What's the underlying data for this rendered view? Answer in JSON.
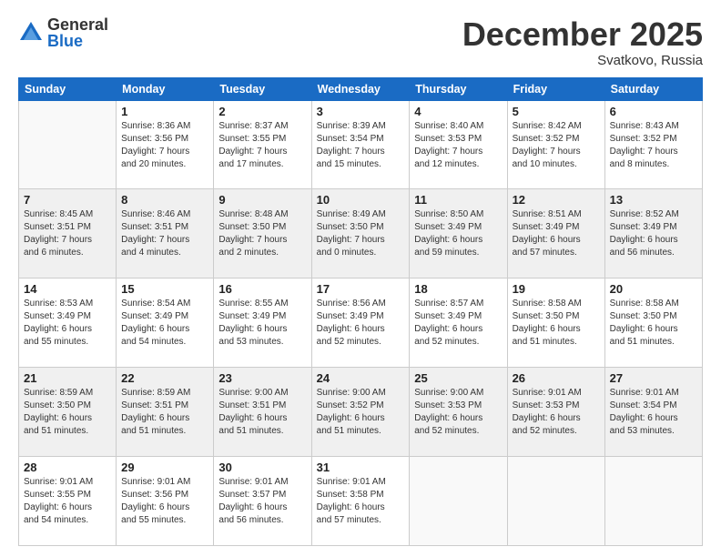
{
  "header": {
    "logo": {
      "general": "General",
      "blue": "Blue"
    },
    "title": "December 2025",
    "location": "Svatkovo, Russia"
  },
  "weekdays": [
    "Sunday",
    "Monday",
    "Tuesday",
    "Wednesday",
    "Thursday",
    "Friday",
    "Saturday"
  ],
  "weeks": [
    [
      {
        "day": "",
        "info": ""
      },
      {
        "day": "1",
        "info": "Sunrise: 8:36 AM\nSunset: 3:56 PM\nDaylight: 7 hours\nand 20 minutes."
      },
      {
        "day": "2",
        "info": "Sunrise: 8:37 AM\nSunset: 3:55 PM\nDaylight: 7 hours\nand 17 minutes."
      },
      {
        "day": "3",
        "info": "Sunrise: 8:39 AM\nSunset: 3:54 PM\nDaylight: 7 hours\nand 15 minutes."
      },
      {
        "day": "4",
        "info": "Sunrise: 8:40 AM\nSunset: 3:53 PM\nDaylight: 7 hours\nand 12 minutes."
      },
      {
        "day": "5",
        "info": "Sunrise: 8:42 AM\nSunset: 3:52 PM\nDaylight: 7 hours\nand 10 minutes."
      },
      {
        "day": "6",
        "info": "Sunrise: 8:43 AM\nSunset: 3:52 PM\nDaylight: 7 hours\nand 8 minutes."
      }
    ],
    [
      {
        "day": "7",
        "info": "Sunrise: 8:45 AM\nSunset: 3:51 PM\nDaylight: 7 hours\nand 6 minutes."
      },
      {
        "day": "8",
        "info": "Sunrise: 8:46 AM\nSunset: 3:51 PM\nDaylight: 7 hours\nand 4 minutes."
      },
      {
        "day": "9",
        "info": "Sunrise: 8:48 AM\nSunset: 3:50 PM\nDaylight: 7 hours\nand 2 minutes."
      },
      {
        "day": "10",
        "info": "Sunrise: 8:49 AM\nSunset: 3:50 PM\nDaylight: 7 hours\nand 0 minutes."
      },
      {
        "day": "11",
        "info": "Sunrise: 8:50 AM\nSunset: 3:49 PM\nDaylight: 6 hours\nand 59 minutes."
      },
      {
        "day": "12",
        "info": "Sunrise: 8:51 AM\nSunset: 3:49 PM\nDaylight: 6 hours\nand 57 minutes."
      },
      {
        "day": "13",
        "info": "Sunrise: 8:52 AM\nSunset: 3:49 PM\nDaylight: 6 hours\nand 56 minutes."
      }
    ],
    [
      {
        "day": "14",
        "info": "Sunrise: 8:53 AM\nSunset: 3:49 PM\nDaylight: 6 hours\nand 55 minutes."
      },
      {
        "day": "15",
        "info": "Sunrise: 8:54 AM\nSunset: 3:49 PM\nDaylight: 6 hours\nand 54 minutes."
      },
      {
        "day": "16",
        "info": "Sunrise: 8:55 AM\nSunset: 3:49 PM\nDaylight: 6 hours\nand 53 minutes."
      },
      {
        "day": "17",
        "info": "Sunrise: 8:56 AM\nSunset: 3:49 PM\nDaylight: 6 hours\nand 52 minutes."
      },
      {
        "day": "18",
        "info": "Sunrise: 8:57 AM\nSunset: 3:49 PM\nDaylight: 6 hours\nand 52 minutes."
      },
      {
        "day": "19",
        "info": "Sunrise: 8:58 AM\nSunset: 3:50 PM\nDaylight: 6 hours\nand 51 minutes."
      },
      {
        "day": "20",
        "info": "Sunrise: 8:58 AM\nSunset: 3:50 PM\nDaylight: 6 hours\nand 51 minutes."
      }
    ],
    [
      {
        "day": "21",
        "info": "Sunrise: 8:59 AM\nSunset: 3:50 PM\nDaylight: 6 hours\nand 51 minutes."
      },
      {
        "day": "22",
        "info": "Sunrise: 8:59 AM\nSunset: 3:51 PM\nDaylight: 6 hours\nand 51 minutes."
      },
      {
        "day": "23",
        "info": "Sunrise: 9:00 AM\nSunset: 3:51 PM\nDaylight: 6 hours\nand 51 minutes."
      },
      {
        "day": "24",
        "info": "Sunrise: 9:00 AM\nSunset: 3:52 PM\nDaylight: 6 hours\nand 51 minutes."
      },
      {
        "day": "25",
        "info": "Sunrise: 9:00 AM\nSunset: 3:53 PM\nDaylight: 6 hours\nand 52 minutes."
      },
      {
        "day": "26",
        "info": "Sunrise: 9:01 AM\nSunset: 3:53 PM\nDaylight: 6 hours\nand 52 minutes."
      },
      {
        "day": "27",
        "info": "Sunrise: 9:01 AM\nSunset: 3:54 PM\nDaylight: 6 hours\nand 53 minutes."
      }
    ],
    [
      {
        "day": "28",
        "info": "Sunrise: 9:01 AM\nSunset: 3:55 PM\nDaylight: 6 hours\nand 54 minutes."
      },
      {
        "day": "29",
        "info": "Sunrise: 9:01 AM\nSunset: 3:56 PM\nDaylight: 6 hours\nand 55 minutes."
      },
      {
        "day": "30",
        "info": "Sunrise: 9:01 AM\nSunset: 3:57 PM\nDaylight: 6 hours\nand 56 minutes."
      },
      {
        "day": "31",
        "info": "Sunrise: 9:01 AM\nSunset: 3:58 PM\nDaylight: 6 hours\nand 57 minutes."
      },
      {
        "day": "",
        "info": ""
      },
      {
        "day": "",
        "info": ""
      },
      {
        "day": "",
        "info": ""
      }
    ]
  ]
}
